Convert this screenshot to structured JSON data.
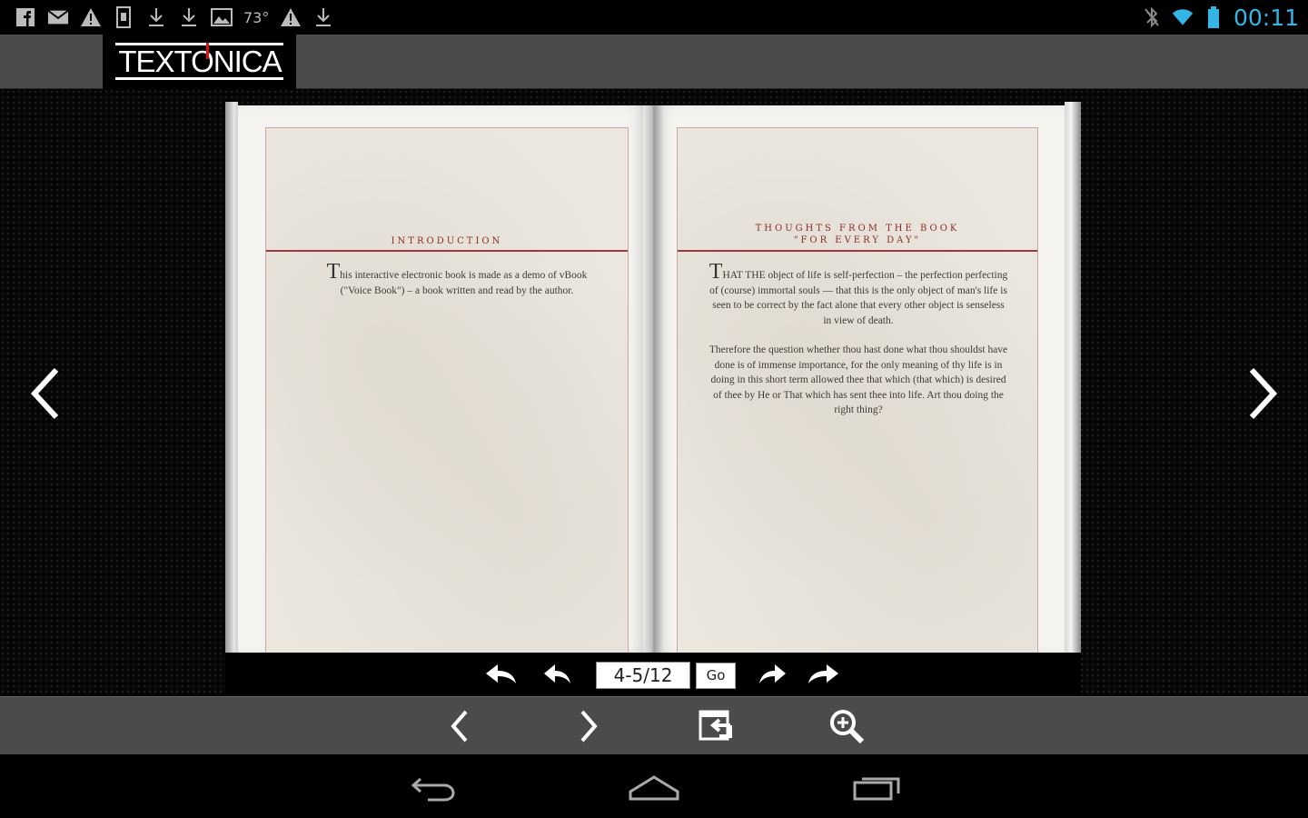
{
  "status_bar": {
    "temperature": "73°",
    "clock": "00:11",
    "left_icons": [
      "facebook-icon",
      "mail-icon",
      "warning-icon",
      "sim-icon",
      "download-icon",
      "download-icon",
      "image-icon",
      "warning-icon",
      "download-icon"
    ],
    "right_icons": [
      "bluetooth-off-icon",
      "wifi-icon",
      "battery-icon"
    ]
  },
  "header": {
    "logo_text": "TEXTONICA"
  },
  "book": {
    "left_page": {
      "chapter_title": "INTRODUCTION",
      "drop_cap": "T",
      "body": "his interactive electronic book is made as a demo of vBook (\"Voice Book\") – a book written and read by the author."
    },
    "right_page": {
      "chapter_title_line1": "THOUGHTS FROM THE BOOK",
      "chapter_title_line2": "\"FOR EVERY DAY\"",
      "drop_cap": "T",
      "paragraph1": "HAT THE object of life is self-perfection – the perfection perfecting of (course) immortal souls — that this is the only object of man's life is seen to be correct by the fact alone that every other object is senseless in view of death.",
      "paragraph2": "Therefore the question whether thou hast done what thou shouldst have done is of immense importance, for the only meaning of thy life is in doing in this short term allowed thee that which (that which) is desired of thee by He or That which has sent thee into life. Art thou doing the right thing?"
    }
  },
  "book_toolbar": {
    "page_indicator": "4-5/12",
    "go_label": "Go"
  },
  "colors": {
    "accent_clock": "#33b5e5",
    "bar_gray": "#4b4b4b",
    "chapter_red": "#8b2a2a"
  }
}
